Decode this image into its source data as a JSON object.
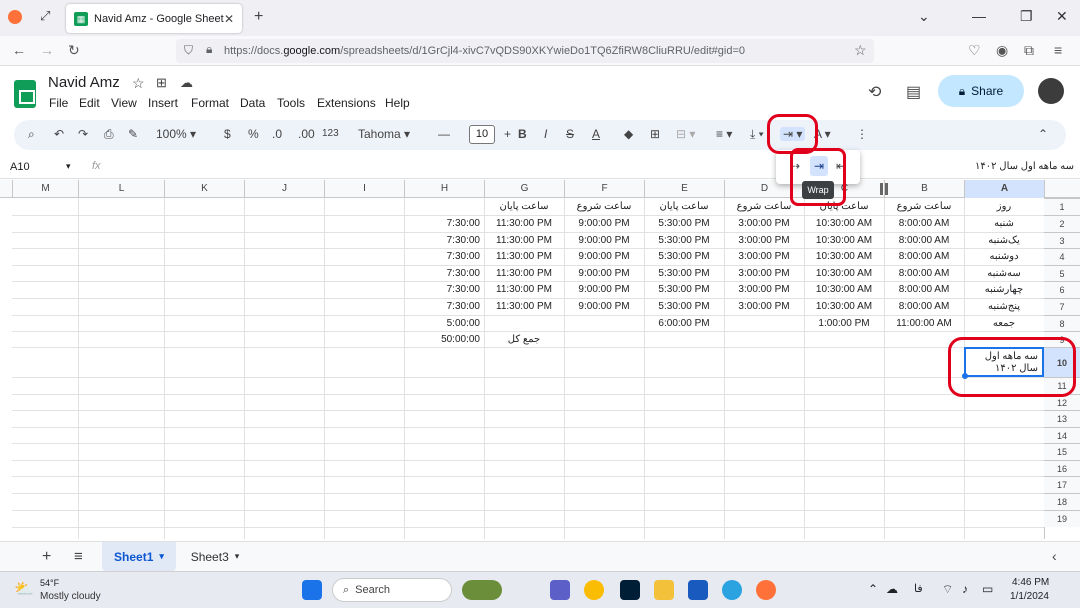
{
  "browser": {
    "tab_title": "Navid Amz - Google Sheets",
    "url_prefix": "https://docs.",
    "url_domain": "google.com",
    "url_rest": "/spreadsheets/d/1GrCjl4-xivC7vQDS90XKYwieDo1TQ6ZfiRW8CliuRRU/edit#gid=0"
  },
  "doc": {
    "title": "Navid Amz",
    "menus": [
      "File",
      "Edit",
      "View",
      "Insert",
      "Format",
      "Data",
      "Tools",
      "Extensions",
      "Help"
    ],
    "share_label": "Share"
  },
  "toolbar": {
    "zoom": "100%",
    "currency": "$",
    "percent": "%",
    "dec_less": ".0",
    "dec_more": ".00",
    "format_123": "123",
    "font": "Tahoma",
    "font_size": "10",
    "bold": "B",
    "italic": "I"
  },
  "formula_bar": {
    "cell_ref": "A10",
    "fx": "fx",
    "content": "سه ماهه اول سال ۱۴۰۲"
  },
  "wrap_menu": {
    "tooltip": "Wrap"
  },
  "columns": [
    "M",
    "L",
    "K",
    "J",
    "I",
    "H",
    "G",
    "F",
    "E",
    "D",
    "C",
    "B",
    "A"
  ],
  "rows": [
    "1",
    "2",
    "3",
    "4",
    "5",
    "6",
    "7",
    "8",
    "9",
    "10",
    "11",
    "12",
    "13",
    "14",
    "15",
    "16",
    "17",
    "18",
    "19"
  ],
  "table": {
    "header": {
      "A": "روز",
      "B": "ساعت شروع",
      "C": "ساعت پایان",
      "D": "ساعت شروع",
      "E": "ساعت پایان",
      "F": "ساعت شروع",
      "G": "ساعت پایان"
    },
    "data": [
      {
        "A": "شنبه",
        "B": "8:00:00 AM",
        "C": "10:30:00 AM",
        "D": "3:00:00 PM",
        "E": "5:30:00 PM",
        "F": "9:00:00 PM",
        "G": "11:30:00 PM",
        "H": "7:30:00"
      },
      {
        "A": "یک‌شنبه",
        "B": "8:00:00 AM",
        "C": "10:30:00 AM",
        "D": "3:00:00 PM",
        "E": "5:30:00 PM",
        "F": "9:00:00 PM",
        "G": "11:30:00 PM",
        "H": "7:30:00"
      },
      {
        "A": "دوشنبه",
        "B": "8:00:00 AM",
        "C": "10:30:00 AM",
        "D": "3:00:00 PM",
        "E": "5:30:00 PM",
        "F": "9:00:00 PM",
        "G": "11:30:00 PM",
        "H": "7:30:00"
      },
      {
        "A": "سه‌شنبه",
        "B": "8:00:00 AM",
        "C": "10:30:00 AM",
        "D": "3:00:00 PM",
        "E": "5:30:00 PM",
        "F": "9:00:00 PM",
        "G": "11:30:00 PM",
        "H": "7:30:00"
      },
      {
        "A": "چهارشنبه",
        "B": "8:00:00 AM",
        "C": "10:30:00 AM",
        "D": "3:00:00 PM",
        "E": "5:30:00 PM",
        "F": "9:00:00 PM",
        "G": "11:30:00 PM",
        "H": "7:30:00"
      },
      {
        "A": "پنج‌شنبه",
        "B": "8:00:00 AM",
        "C": "10:30:00 AM",
        "D": "3:00:00 PM",
        "E": "5:30:00 PM",
        "F": "9:00:00 PM",
        "G": "11:30:00 PM",
        "H": "7:30:00"
      },
      {
        "A": "جمعه",
        "B": "11:00:00 AM",
        "C": "1:00:00 PM",
        "D": "",
        "E": "6:00:00 PM",
        "F": "",
        "G": "",
        "H": "5:00:00"
      }
    ],
    "total_label": "جمع کل",
    "total_value": "50:00:00",
    "selected_cell_text": "سه ماهه اول سال ۱۴۰۲"
  },
  "sheets": {
    "tabs": [
      "Sheet1",
      "Sheet3"
    ],
    "active": "Sheet1"
  },
  "taskbar": {
    "weather_temp": "54°F",
    "weather_desc": "Mostly cloudy",
    "search_label": "Search",
    "lang": "فا",
    "time": "4:46 PM",
    "date": "1/1/2024"
  },
  "colors": {
    "accent": "#1a73e8",
    "highlight_ring": "#e0001b",
    "sheets_green": "#0f9d58",
    "share_bg": "#c2e7ff"
  }
}
